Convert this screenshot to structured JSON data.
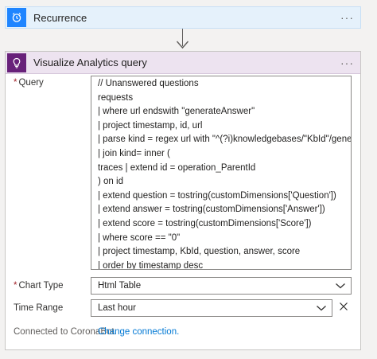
{
  "recurrence": {
    "title": "Recurrence",
    "more": "···",
    "icon": "alarm-clock-icon"
  },
  "visualize": {
    "title": "Visualize Analytics query",
    "more": "···",
    "icon": "lightbulb-icon",
    "query": {
      "label": "Query",
      "required_mark": "*",
      "lines": [
        "// Unanswered questions",
        "requests",
        "| where url endswith \"generateAnswer\"",
        "| project timestamp, id, url",
        "| parse kind = regex url with \"^(?i)knowledgebases/\"KbId\"/generateAnswer\"",
        "| join kind= inner (",
        "traces | extend id = operation_ParentId",
        ") on id",
        "| extend question = tostring(customDimensions['Question'])",
        "| extend answer = tostring(customDimensions['Answer'])",
        "| extend score = tostring(customDimensions['Score'])",
        "| where score == \"0\"",
        "| project timestamp, KbId, question, answer, score",
        "| order by timestamp desc"
      ]
    },
    "chart_type": {
      "label": "Chart Type",
      "required_mark": "*",
      "value": "Html Table"
    },
    "time_range": {
      "label": "Time Range",
      "value": "Last hour"
    },
    "connection": {
      "text": "Connected to CoronaBot.",
      "link": "Change connection."
    }
  },
  "colors": {
    "recurrence_accent": "#1f85ff",
    "visualize_accent": "#68217a",
    "link": "#0078d4"
  }
}
